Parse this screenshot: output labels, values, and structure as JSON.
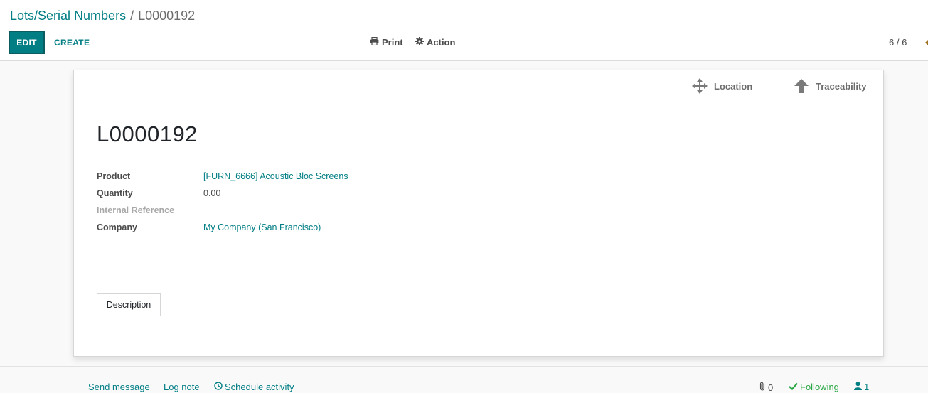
{
  "breadcrumb": {
    "parent": "Lots/Serial Numbers",
    "separator": "/",
    "current": "L0000192"
  },
  "toolbar": {
    "edit_label": "EDIT",
    "create_label": "CREATE",
    "print_label": "Print",
    "action_label": "Action"
  },
  "pager": {
    "value": "6 / 6"
  },
  "smart_buttons": [
    {
      "label": "Location",
      "icon": "arrows-move-icon"
    },
    {
      "label": "Traceability",
      "icon": "arrow-up-icon"
    }
  ],
  "record": {
    "title": "L0000192",
    "fields": [
      {
        "label": "Product",
        "value": "[FURN_6666] Acoustic Bloc Screens"
      },
      {
        "label": "Quantity",
        "value": "0.00"
      },
      {
        "label": "Internal Reference",
        "value": ""
      },
      {
        "label": "Company",
        "value": "My Company (San Francisco)"
      }
    ]
  },
  "tabs": [
    {
      "label": "Description"
    }
  ],
  "chatter": {
    "send_message": "Send message",
    "log_note": "Log note",
    "schedule_activity": "Schedule activity",
    "attachments_count": "0",
    "following_label": "Following",
    "followers_count": "1"
  },
  "colors": {
    "accent": "#017e84",
    "following": "#28a745",
    "text": "#4c4c4c"
  }
}
